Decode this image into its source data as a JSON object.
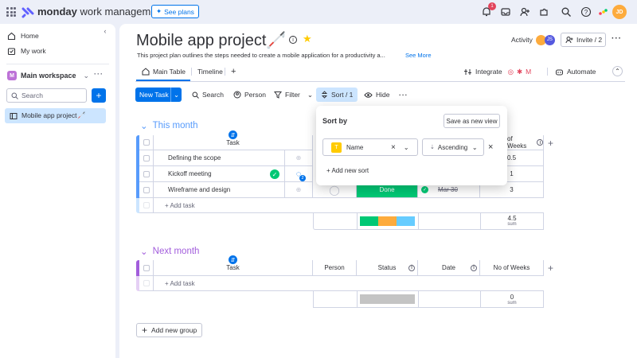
{
  "topbar": {
    "brand_bold": "monday",
    "brand_rest": " work management",
    "see_plans": "See plans",
    "notif_count": "1",
    "user_initials": "JD"
  },
  "sidebar": {
    "items": [
      {
        "label": "Home"
      },
      {
        "label": "My work"
      }
    ],
    "workspace": {
      "icon_letter": "M",
      "name": "Main workspace"
    },
    "search_placeholder": "Search",
    "board": "Mobile app project🦯"
  },
  "board": {
    "title": "Mobile app project🦯",
    "description": "This project plan outlines the steps needed to create a mobile application for a productivity a...",
    "see_more": "See More",
    "activity_label": "Activity",
    "activity_avatar": "JS",
    "invite_label": "Invite / 2",
    "tabs": [
      {
        "label": "Main Table"
      },
      {
        "label": "Timeline"
      }
    ],
    "integrate": "Integrate",
    "automate": "Automate"
  },
  "toolbar": {
    "new_task": "New Task",
    "search": "Search",
    "person": "Person",
    "filter": "Filter",
    "sort": "Sort / 1",
    "hide": "Hide"
  },
  "sort_popup": {
    "title": "Sort by",
    "save_view": "Save as new view",
    "column": "Name",
    "direction": "Ascending",
    "add_sort": "+ Add new sort"
  },
  "groups": [
    {
      "name": "This month",
      "color": "#579bfc",
      "headers": {
        "task": "Task",
        "weeks": "of Weeks"
      },
      "rows": [
        {
          "task": "Defining the scope",
          "weeks": "0.5"
        },
        {
          "task": "Kickoff meeting",
          "weeks": "1",
          "updates": "2"
        },
        {
          "task": "Wireframe and design",
          "status": "Done",
          "date": "Mar 30",
          "weeks": "3"
        }
      ],
      "add_task": "+ Add task",
      "sum_value": "4.5",
      "sum_label": "sum"
    },
    {
      "name": "Next month",
      "color": "#a25ddc",
      "headers": {
        "task": "Task",
        "person": "Person",
        "status": "Status",
        "date": "Date",
        "weeks": "No of Weeks"
      },
      "add_task": "+ Add task",
      "sum_value": "0",
      "sum_label": "sum"
    }
  ],
  "add_group": "Add new group"
}
